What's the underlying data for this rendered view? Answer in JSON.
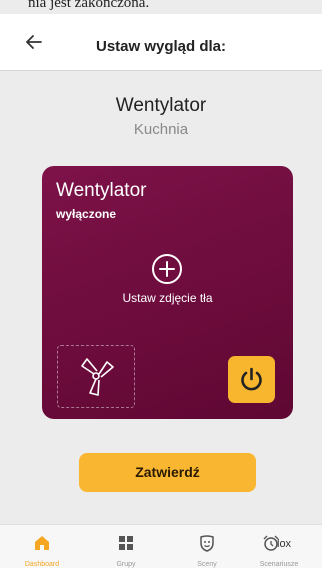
{
  "status_bar": {
    "text": "nia jest zakończona."
  },
  "header": {
    "title": "Ustaw wygląd dla:",
    "back_icon": "arrow-left-icon"
  },
  "device": {
    "name": "Wentylator",
    "room": "Kuchnia"
  },
  "card": {
    "title": "Wentylator",
    "state": "wyłączone",
    "set_background_label": "Ustaw zdjęcie tła",
    "add_icon": "plus-circle-icon",
    "device_icon": "fan-icon",
    "power_icon": "power-icon",
    "gradient_start": "#7d1248",
    "gradient_end": "#5f0733",
    "power_color": "#f8b52e"
  },
  "confirm_button": {
    "label": "Zatwierdź",
    "color": "#f9b731"
  },
  "bottom_nav": {
    "items": [
      {
        "label": "Dashboard",
        "icon": "home-icon",
        "active": true
      },
      {
        "label": "Grupy",
        "icon": "grid-icon",
        "active": false
      },
      {
        "label": "Sceny",
        "icon": "scene-icon",
        "active": false
      },
      {
        "label": "Scenariusze",
        "icon": "alarm-clock-icon",
        "active": false
      }
    ],
    "brand": "lox"
  }
}
